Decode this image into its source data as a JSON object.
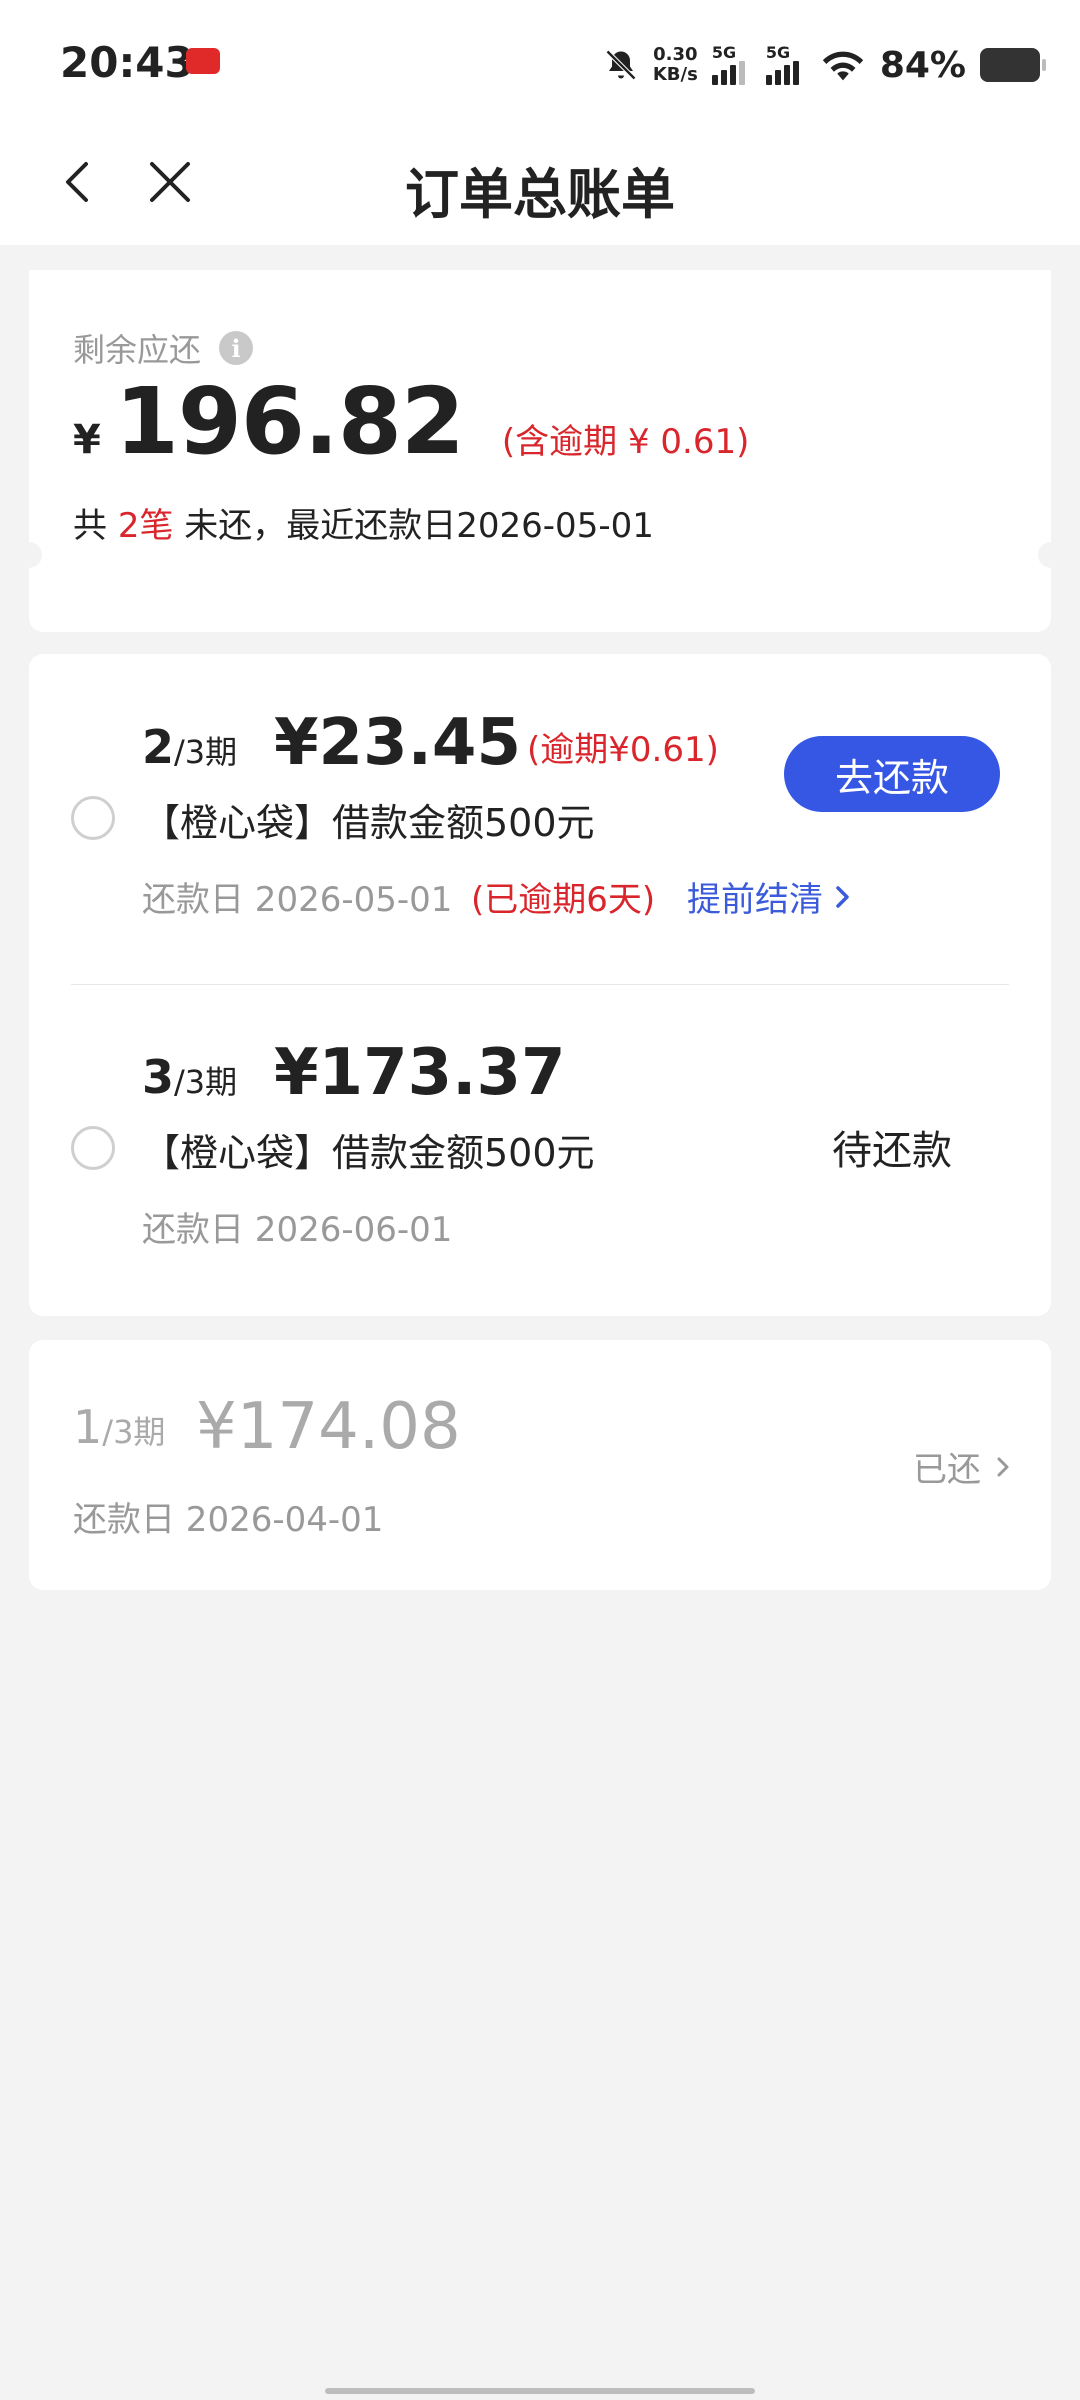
{
  "status_bar": {
    "time": "20:43",
    "net_speed_value": "0.30",
    "net_speed_unit": "KB/s",
    "sim1_label": "5G",
    "sim2_label": "5G",
    "battery_percent": "84%"
  },
  "nav": {
    "title": "订单总账单",
    "back_icon": "chevron-left-icon",
    "close_icon": "close-icon"
  },
  "summary": {
    "label": "剩余应还",
    "currency": "¥",
    "amount": "196.82",
    "overdue_note": "(含逾期 ¥ 0.61)",
    "line_prefix": "共 ",
    "count": "2笔",
    "line_suffix": " 未还，最近还款日2026-05-01"
  },
  "installments": [
    {
      "period_num": "2",
      "period_den": "/3期",
      "amount": "¥23.45",
      "overdue": "(逾期¥0.61)",
      "product": "【橙心袋】借款金额500元",
      "due": "还款日 2026-05-01",
      "late_note": "(已逾期6天)",
      "early_settle": "提前结清",
      "action": "去还款"
    },
    {
      "period_num": "3",
      "period_den": "/3期",
      "amount": "¥173.37",
      "product": "【橙心袋】借款金额500元",
      "due": "还款日 2026-06-01",
      "status": "待还款"
    }
  ],
  "paid": {
    "period_num": "1",
    "period_den": "/3期",
    "amount": "¥174.08",
    "due": "还款日 2026-04-01",
    "status": "已还"
  },
  "colors": {
    "accent_blue": "#3557e4",
    "overdue_red": "#d9262c",
    "link_blue": "#3b5bdb"
  }
}
